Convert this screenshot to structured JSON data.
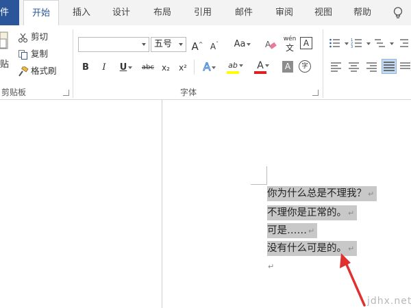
{
  "tabs": {
    "file": "件",
    "home": "开始",
    "insert": "插入",
    "design": "设计",
    "layout": "布局",
    "references": "引用",
    "mailings": "邮件",
    "review": "审阅",
    "view": "视图",
    "help": "帮助"
  },
  "clipboard": {
    "paste": "贴",
    "cut": "剪切",
    "copy": "复制",
    "format_painter": "格式刷",
    "group_label": "剪贴板"
  },
  "font": {
    "font_name_value": "",
    "font_size_value": "五号",
    "grow": "A",
    "shrink": "A",
    "change_case": "Aa",
    "phonetic": "wén",
    "phonetic_char": "文",
    "char_border": "A",
    "bold": "B",
    "italic": "I",
    "underline": "U",
    "strikethrough": "abc",
    "subscript": "x₂",
    "superscript": "x²",
    "text_effects": "A",
    "highlight": "ab",
    "font_color": "A",
    "char_shading": "A",
    "enclose": "字",
    "group_label": "字体"
  },
  "colors": {
    "accent": "#2b579a",
    "highlight_bar": "#ffff00",
    "font_color_bar": "#e02020",
    "selection": "#c8c8c8",
    "arrow": "#e03030"
  },
  "document": {
    "lines": [
      "你为什么总是不理我？",
      "不理你是正常的。",
      "可是……",
      "没有什么可是的。"
    ],
    "paragraph_mark": "↵"
  },
  "watermark": "jdhx.net"
}
